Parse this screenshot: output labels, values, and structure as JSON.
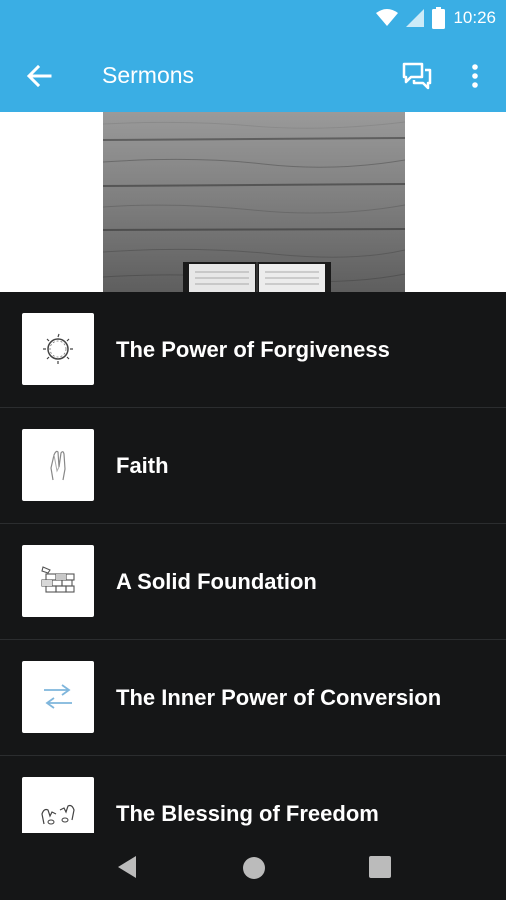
{
  "status_bar": {
    "time": "10:26"
  },
  "app_bar": {
    "title": "Sermons"
  },
  "sermons": [
    {
      "title": "The Power of Forgiveness",
      "icon": "crown-of-thorns-icon"
    },
    {
      "title": "Faith",
      "icon": "praying-hands-icon"
    },
    {
      "title": "A Solid Foundation",
      "icon": "brick-wall-icon"
    },
    {
      "title": "The Inner Power of Conversion",
      "icon": "exchange-arrows-icon"
    },
    {
      "title": "The Blessing of Freedom",
      "icon": "broken-chains-icon"
    }
  ],
  "colors": {
    "accent": "#3aaee4",
    "background": "#151617",
    "divider": "#2b2d2f"
  }
}
